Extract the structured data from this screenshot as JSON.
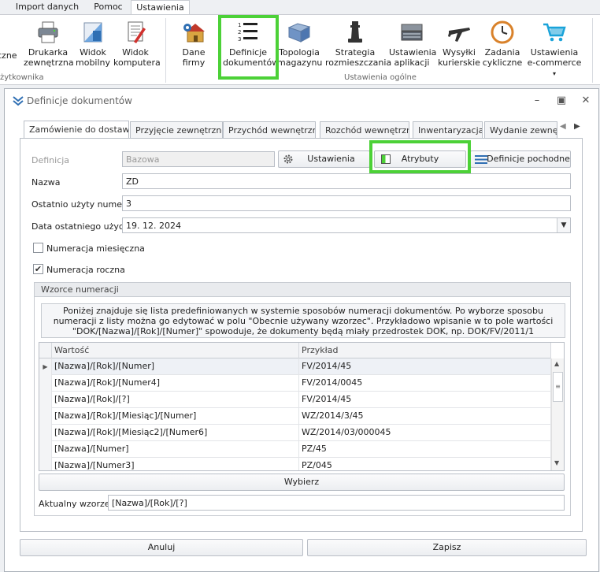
{
  "menu": {
    "tabs": [
      "Import danych",
      "Pomoc",
      "Ustawienia"
    ]
  },
  "ribbon": {
    "left_partial_label": "czne",
    "left_group_label": "żytkownika",
    "items": [
      {
        "line1": "Drukarka",
        "line2": "zewnętrzna",
        "icon": "printer-icon"
      },
      {
        "line1": "Widok",
        "line2": "mobilny",
        "icon": "mobile-view-icon"
      },
      {
        "line1": "Widok",
        "line2": "komputera",
        "icon": "computer-view-icon"
      },
      {
        "line1": "Dane firmy",
        "line2": "",
        "icon": "company-data-icon"
      },
      {
        "line1": "Definicje",
        "line2": "dokumentów",
        "icon": "numbered-list-icon"
      },
      {
        "line1": "Topologia",
        "line2": "magazynu",
        "icon": "warehouse-map-icon"
      },
      {
        "line1": "Strategia",
        "line2": "rozmieszczania",
        "icon": "chess-piece-icon"
      },
      {
        "line1": "Ustawienia",
        "line2": "aplikacji",
        "icon": "keyboard-icon"
      },
      {
        "line1": "Wysyłki",
        "line2": "kurierskie",
        "icon": "airplane-icon"
      },
      {
        "line1": "Zadania",
        "line2": "cykliczne",
        "icon": "clock-icon"
      },
      {
        "line1": "Ustawienia",
        "line2": "e-commerce",
        "icon": "shopping-cart-icon"
      }
    ],
    "group_label": "Ustawienia ogólne"
  },
  "dialog": {
    "title": "Definicje dokumentów",
    "tabs": [
      "Zamówienie do dostawcy",
      "Przyjęcie zewnętrzne",
      "Przychód wewnętrzny",
      "Rozchód wewnętrzny",
      "Inwentaryzacja",
      "Wydanie zewnętrzne"
    ],
    "definicja_label": "Definicja",
    "definicja_value": "Bazowa",
    "ustawienia_button": "Ustawienia",
    "atrybuty_button": "Atrybuty",
    "definicje_pochodne_button": "Definicje pochodne",
    "nazwa_label": "Nazwa",
    "nazwa_value": "ZD",
    "ostatni_numer_label": "Ostatnio użyty numer",
    "ostatni_numer_value": "3",
    "data_label": "Data ostatniego użycia",
    "data_value": "19. 12. 2024",
    "numeracja_miesieczna_label": "Numeracja miesięczna",
    "numeracja_miesieczna_checked": false,
    "numeracja_roczna_label": "Numeracja roczna",
    "numeracja_roczna_checked": true,
    "wzorce_title": "Wzorce numeracji",
    "wzorce_description": "Poniżej znajduje się lista predefiniowanych w systemie sposobów numeracji dokumentów. Po wyborze sposobu numeracji z listy można go edytować w polu \"Obecnie używany wzorzec\". Przykładowo wpisanie w to pole wartości \"DOK/[Nazwa]/[Rok]/[Numer]\" spowoduje, że dokumenty będą miały przedrostek DOK, np. DOK/FV/2011/1",
    "grid": {
      "columns": [
        "Wartość",
        "Przykład"
      ],
      "rows": [
        [
          "[Nazwa]/[Rok]/[Numer]",
          "FV/2014/45"
        ],
        [
          "[Nazwa]/[Rok]/[Numer4]",
          "FV/2014/0045"
        ],
        [
          "[Nazwa]/[Rok]/[?]",
          "FV/2014/45"
        ],
        [
          "[Nazwa]/[Rok]/[Miesiąc]/[Numer]",
          "WZ/2014/3/45"
        ],
        [
          "[Nazwa]/[Rok]/[Miesiąc2]/[Numer6]",
          "WZ/2014/03/000045"
        ],
        [
          "[Nazwa]/[Numer]",
          "PZ/45"
        ],
        [
          "[Nazwa]/[Numer3]",
          "PZ/045"
        ]
      ]
    },
    "wybierz_button": "Wybierz",
    "aktualny_wzorzec_label": "Aktualny wzorzec",
    "aktualny_wzorzec_value": "[Nazwa]/[Rok]/[?]",
    "anuluj_button": "Anuluj",
    "zapisz_button": "Zapisz"
  },
  "colors": {
    "highlight": "#4cd137"
  }
}
